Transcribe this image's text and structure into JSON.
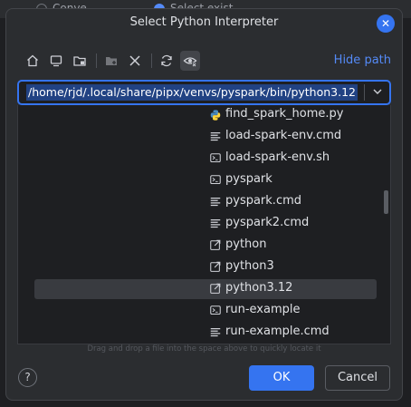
{
  "background": {
    "items": [
      {
        "label": "Conve",
        "selected": false
      },
      {
        "label": "Select exist",
        "selected": true
      }
    ]
  },
  "dialog": {
    "title": "Select Python Interpreter",
    "close_icon": "close-icon"
  },
  "toolbar": {
    "buttons": [
      {
        "name": "home",
        "icon": "home-icon"
      },
      {
        "name": "desktop",
        "icon": "desktop-icon"
      },
      {
        "name": "project",
        "icon": "project-folder-icon"
      },
      {
        "name": "new-folder",
        "icon": "new-folder-icon",
        "disabled": true
      },
      {
        "name": "delete",
        "icon": "delete-icon"
      },
      {
        "name": "refresh",
        "icon": "refresh-icon"
      },
      {
        "name": "show-hidden",
        "icon": "show-hidden-icon",
        "active": true
      }
    ],
    "hide_path_label": "Hide path"
  },
  "path": {
    "value": "/home/rjd/.local/share/pipx/venvs/pyspark/bin/python3.12"
  },
  "files": [
    {
      "name": "find_spark_home.py",
      "icon": "python-file-icon"
    },
    {
      "name": "load-spark-env.cmd",
      "icon": "text-file-icon"
    },
    {
      "name": "load-spark-env.sh",
      "icon": "shell-script-icon"
    },
    {
      "name": "pyspark",
      "icon": "shell-script-icon"
    },
    {
      "name": "pyspark.cmd",
      "icon": "text-file-icon"
    },
    {
      "name": "pyspark2.cmd",
      "icon": "text-file-icon"
    },
    {
      "name": "python",
      "icon": "symlink-icon"
    },
    {
      "name": "python3",
      "icon": "symlink-icon"
    },
    {
      "name": "python3.12",
      "icon": "symlink-icon",
      "selected": true
    },
    {
      "name": "run-example",
      "icon": "shell-script-icon"
    },
    {
      "name": "run-example.cmd",
      "icon": "text-file-icon"
    }
  ],
  "hint": "Drag and drop a file into the space above to quickly locate it",
  "footer": {
    "help_label": "?",
    "ok_label": "OK",
    "cancel_label": "Cancel"
  },
  "colors": {
    "accent": "#3574f0",
    "link": "#548af7",
    "selection": "#393b40",
    "path_highlight": "#214283"
  }
}
